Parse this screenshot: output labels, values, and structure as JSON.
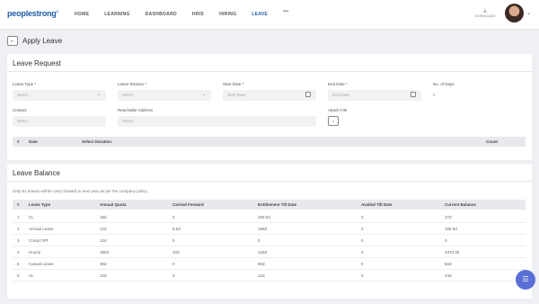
{
  "header": {
    "logo": "peoplestrong",
    "nav": [
      {
        "label": "HOME",
        "active": false
      },
      {
        "label": "LEARNING",
        "active": false
      },
      {
        "label": "DASHBOARD",
        "active": false
      },
      {
        "label": "HRIS",
        "active": false
      },
      {
        "label": "HIRING",
        "active": false
      },
      {
        "label": "LEAVE",
        "active": true
      }
    ],
    "more": "•••",
    "download_label": "DOWNLOADS"
  },
  "page": {
    "title": "Apply Leave",
    "back_icon": "←"
  },
  "leave_request": {
    "title": "Leave Request",
    "fields": {
      "leave_type": {
        "label": "Leave Type *",
        "placeholder": "Select"
      },
      "leave_reason": {
        "label": "Leave Reason *",
        "placeholder": "Select"
      },
      "start_date": {
        "label": "Start Date *",
        "placeholder": "Start Date"
      },
      "end_date": {
        "label": "End Date *",
        "placeholder": "End Date"
      },
      "no_of_days": {
        "label": "No. of Days",
        "value": "0"
      },
      "contact": {
        "label": "Contact",
        "placeholder": "Select"
      },
      "reachable_address": {
        "label": "Reachable Address",
        "placeholder": "Select"
      },
      "attach_file": {
        "label": "Attach File",
        "icon": "attach-icon"
      }
    },
    "table_headers": {
      "hash": "#",
      "date": "Date",
      "duration": "Select Duration",
      "count": "Count"
    }
  },
  "leave_balance": {
    "title": "Leave Balance",
    "note": "Only EL leaves will be carry forward to next year as per the company policy.",
    "headers": [
      "#",
      "Leave Type",
      "Annual Quota",
      "Carried Forward",
      "Entitlement Till Date",
      "Availed Till Date",
      "Current Balance"
    ],
    "rows": [
      [
        "1",
        "CL",
        "18d",
        "0",
        "209.5d",
        "0",
        "27d"
      ],
      [
        "2",
        "Annual Leave",
        "12d",
        "8.5d",
        "198d",
        "0",
        "158.5d"
      ],
      [
        "3",
        "Comp OFF",
        "12d",
        "0",
        "0",
        "0",
        "0"
      ],
      [
        "4",
        "Hourly",
        "180d",
        "10d",
        "429d",
        "0",
        "437d 3h"
      ],
      [
        "5",
        "Casual Leave",
        "30d",
        "0",
        "60d",
        "0",
        "60d"
      ],
      [
        "6",
        "AL",
        "12d",
        "0",
        "12d",
        "0",
        "24d"
      ]
    ]
  },
  "colors": {
    "brand": "#1f5ca8",
    "chat": "#5a6fd6"
  }
}
